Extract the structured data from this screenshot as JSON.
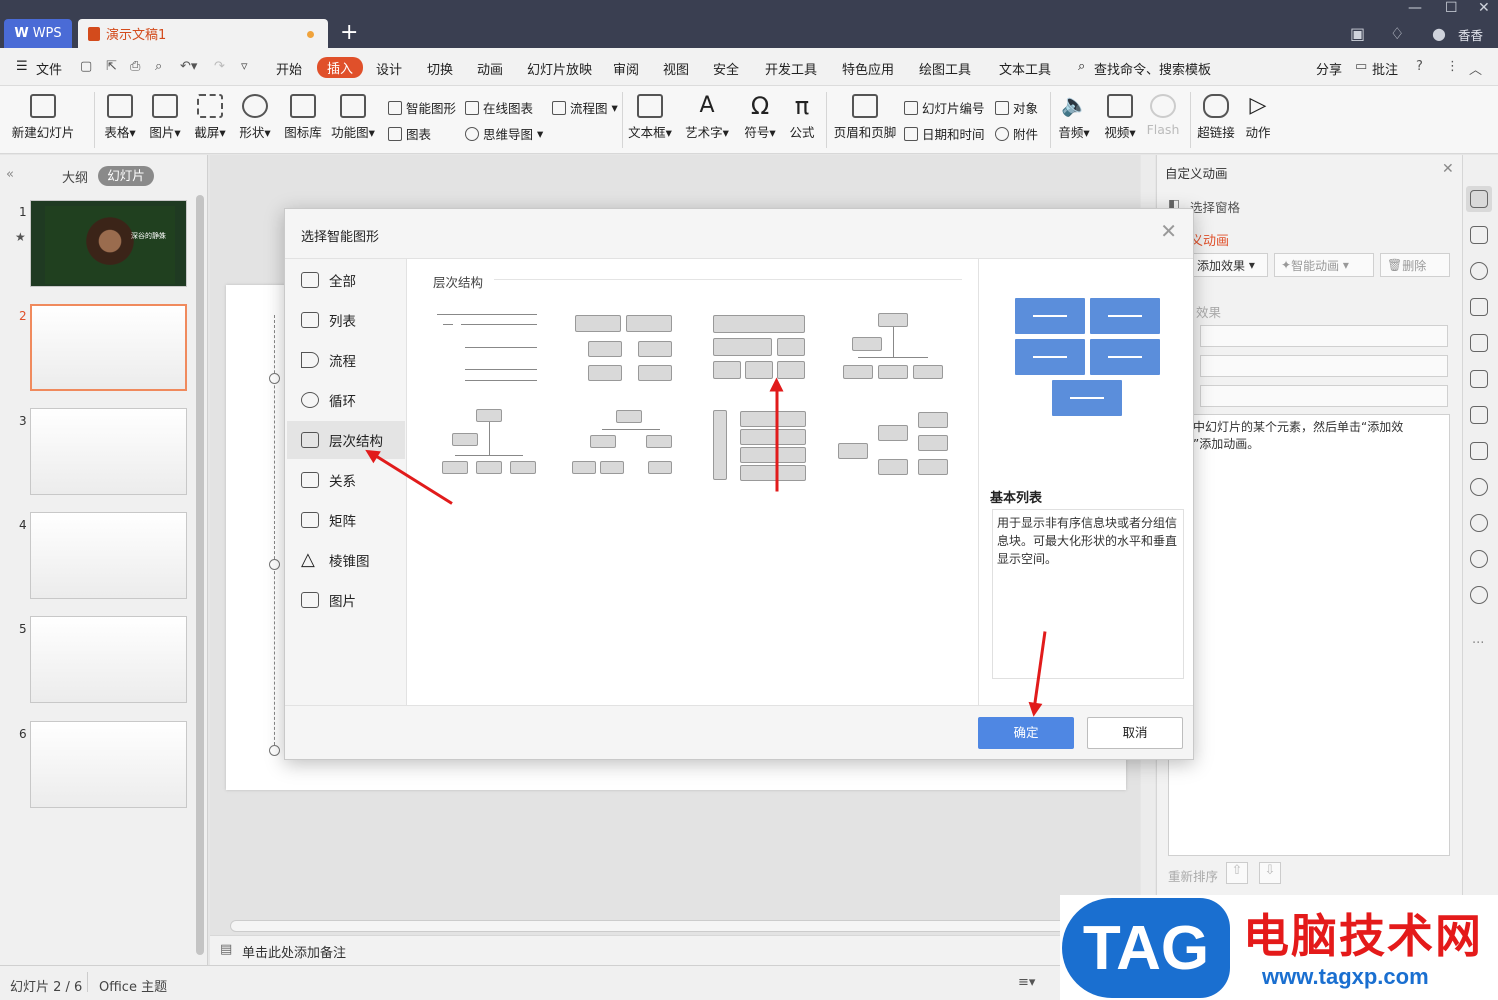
{
  "titlebar": {
    "wps_label": "WPS",
    "doc_tab": "演示文稿1",
    "new_tab": "+",
    "user": "香香"
  },
  "menubar": {
    "file": "文件",
    "items": [
      "开始",
      "插入",
      "设计",
      "切换",
      "动画",
      "幻灯片放映",
      "审阅",
      "视图",
      "安全",
      "开发工具",
      "特色应用",
      "绘图工具",
      "文本工具"
    ],
    "search": "查找命令、搜索模板",
    "share": "分享",
    "comment": "批注"
  },
  "ribbon": {
    "new_slide": "新建幻灯片",
    "table": "表格",
    "picture": "图片",
    "screenshot": "截屏",
    "shape": "形状",
    "iconlib": "图标库",
    "funcchart": "功能图",
    "smartart": "智能图形",
    "chart": "图表",
    "online_chart": "在线图表",
    "mindmap": "思维导图",
    "flowchart": "流程图",
    "textbox": "文本框",
    "wordart": "艺术字",
    "symbol": "符号",
    "formula": "公式",
    "header_footer": "页眉和页脚",
    "slide_number": "幻灯片编号",
    "datetime": "日期和时间",
    "object": "对象",
    "attachment": "附件",
    "audio": "音频",
    "video": "视频",
    "flash": "Flash",
    "hyperlink": "超链接",
    "action": "动作"
  },
  "leftpanel": {
    "outline_tab": "大纲",
    "slides_tab": "幻灯片",
    "thumbs": [
      "1",
      "2",
      "3",
      "4",
      "5",
      "6"
    ],
    "thumb1_text": "深谷的静姝"
  },
  "notes": {
    "placeholder": "单击此处添加备注"
  },
  "rightpanel": {
    "title": "自定义动画",
    "select_pane": "选择窗格",
    "custom_anim": "义动画",
    "add_effect": "添加效果",
    "smart_anim": "智能动画",
    "delete": "删除",
    "effect_label": "效果",
    "hint_line1": "中幻灯片的某个元素，然后单击“添加效",
    "hint_line2": "”添加动画。",
    "reorder": "重新排序"
  },
  "status": {
    "slide_info": "幻灯片 2 / 6",
    "theme": "Office 主题"
  },
  "dialog": {
    "title": "选择智能图形",
    "categories": [
      "全部",
      "列表",
      "流程",
      "循环",
      "层次结构",
      "关系",
      "矩阵",
      "棱锥图",
      "图片"
    ],
    "section_title": "层次结构",
    "preview_title": "基本列表",
    "preview_desc": "用于显示非有序信息块或者分组信息块。可最大化形状的水平和垂直显示空间。",
    "ok": "确定",
    "cancel": "取消"
  },
  "watermark": {
    "logo": "TAG",
    "cn": "电脑技术网",
    "url": "www.tagxp.com"
  },
  "colors": {
    "titlebar": "#3a3f51",
    "accent": "#e0502a",
    "preview_blue": "#5b8edb",
    "ok_button": "#4f87e3",
    "arrow": "#e11b1b"
  }
}
